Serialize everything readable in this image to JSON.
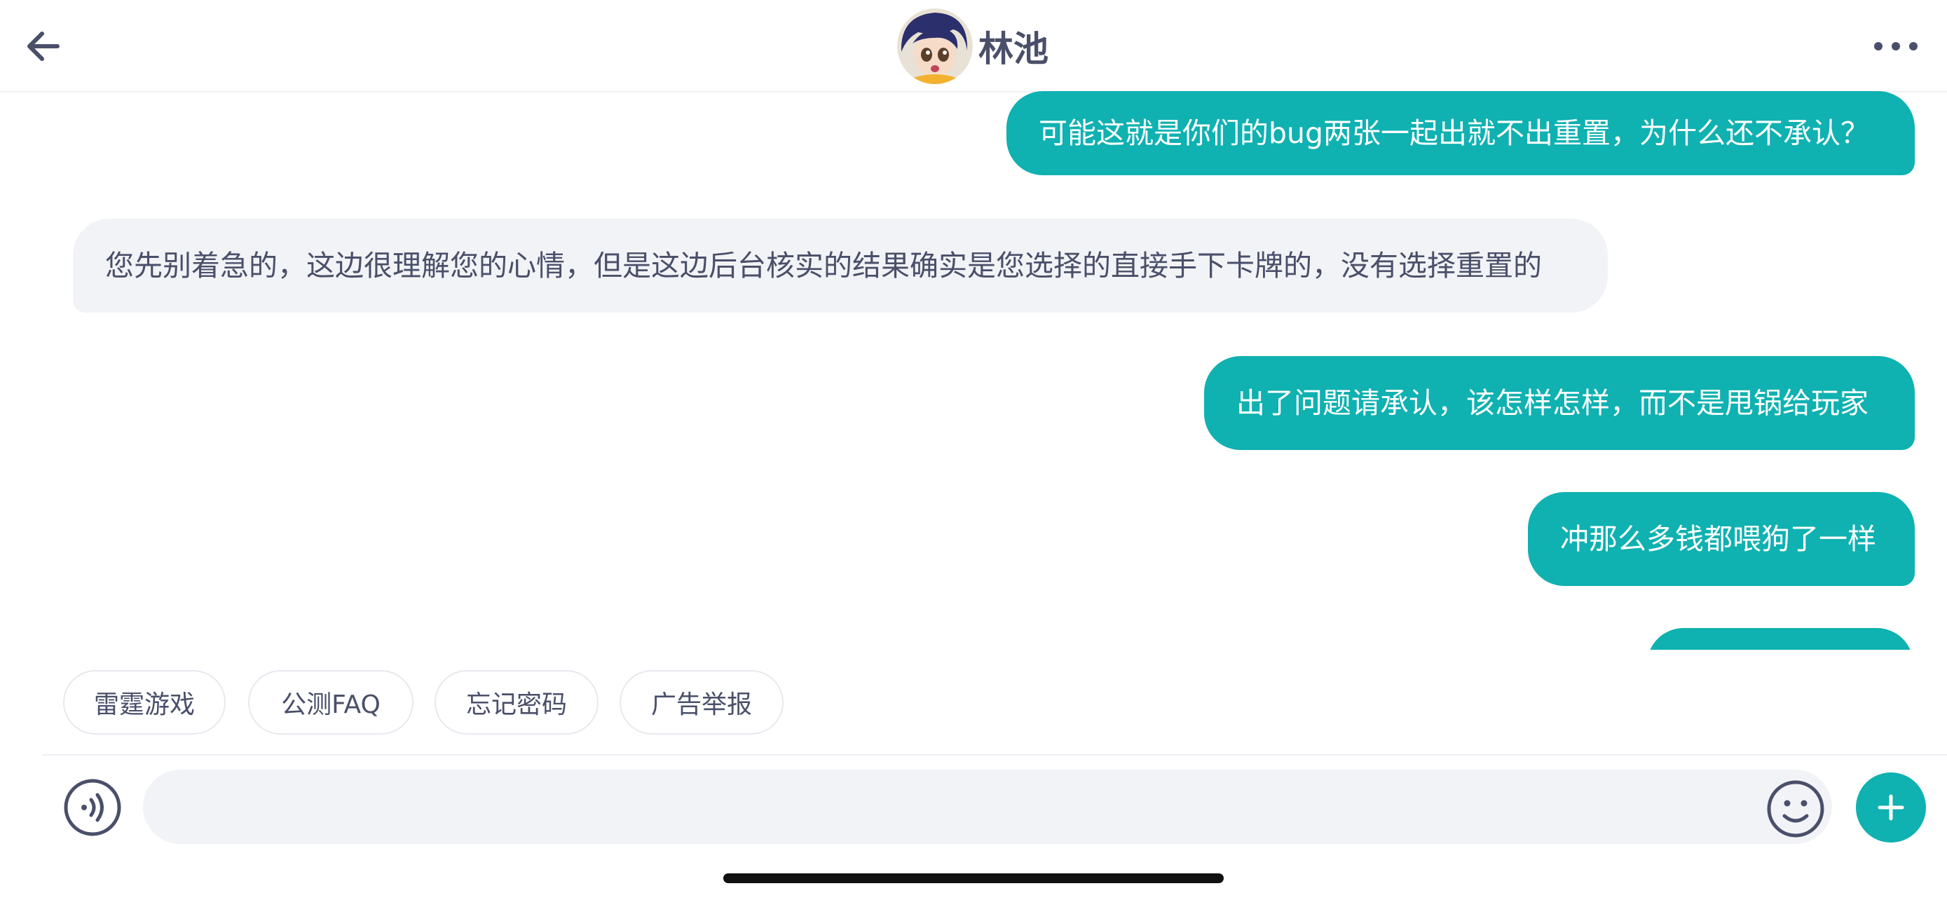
{
  "header": {
    "back_icon": "arrow-left-icon",
    "title": "林池",
    "avatar": "contact-avatar",
    "more_icon": "more-horizontal-icon"
  },
  "messages": [
    {
      "direction": "outgoing",
      "text": "可能这就是你们的bug两张一起出就不出重置，为什么还不承认？"
    },
    {
      "direction": "incoming",
      "text": "您先别着急的，这边很理解您的心情，但是这边后台核实的结果确实是您选择的直接手下卡牌的，没有选择重置的"
    },
    {
      "direction": "outgoing",
      "text": "出了问题请承认，该怎样怎样，而不是甩锅给玩家"
    },
    {
      "direction": "outgoing",
      "text": "冲那么多钱都喂狗了一样"
    }
  ],
  "quick_replies": [
    "雷霆游戏",
    "公测FAQ",
    "忘记密码",
    "广告举报"
  ],
  "input_bar": {
    "voice_icon": "voice-input-icon",
    "message_value": "",
    "emoji_icon": "emoji-icon",
    "plus_icon": "plus-icon"
  },
  "colors": {
    "accent": "#0fb1b1",
    "incoming_bubble": "#f1f3f6",
    "text": "#4a4f6a"
  }
}
